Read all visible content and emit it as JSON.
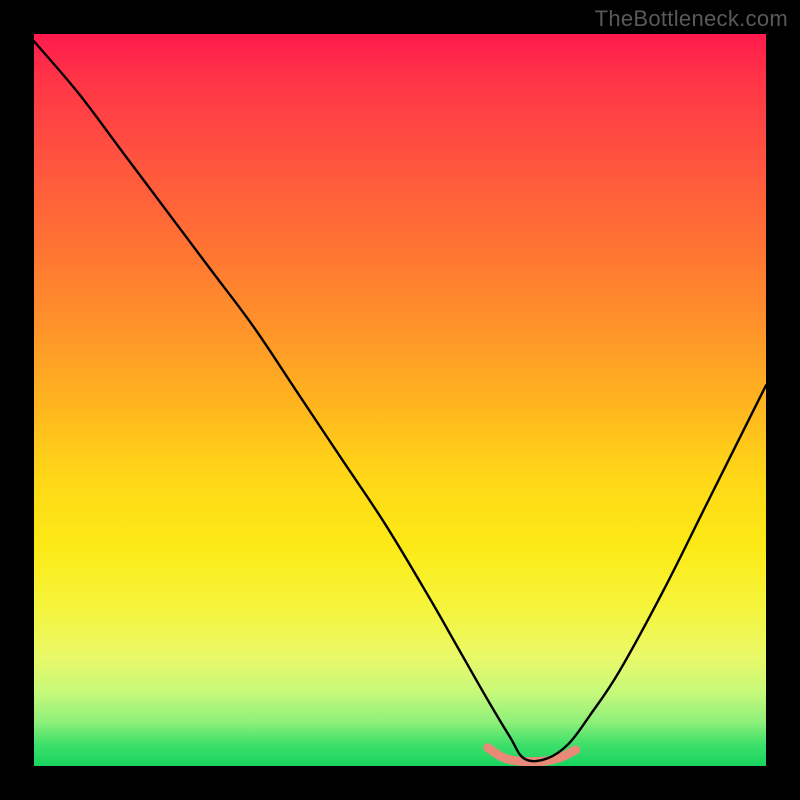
{
  "watermark": "TheBottleneck.com",
  "chart_data": {
    "type": "line",
    "title": "",
    "xlabel": "",
    "ylabel": "",
    "xlim": [
      0,
      100
    ],
    "ylim": [
      0,
      100
    ],
    "grid": false,
    "legend": false,
    "note": "Background encodes a vertical red→yellow→green gradient. Primary curve is an asymmetric V-shaped black line with its minimum near x≈67–70, y≈0. A short salmon segment sits at the trough.",
    "gradient_stops": [
      {
        "pos": 0,
        "color": "#ff1a4d"
      },
      {
        "pos": 16,
        "color": "#ff5040"
      },
      {
        "pos": 40,
        "color": "#ff932a"
      },
      {
        "pos": 60,
        "color": "#ffd617"
      },
      {
        "pos": 78,
        "color": "#f6f43a"
      },
      {
        "pos": 90,
        "color": "#c6f97a"
      },
      {
        "pos": 100,
        "color": "#17d45f"
      }
    ],
    "series": [
      {
        "name": "curve-main",
        "color": "#000000",
        "x": [
          0,
          6,
          12,
          18,
          24,
          30,
          36,
          42,
          48,
          54,
          58,
          62,
          65,
          67,
          70,
          73,
          76,
          80,
          86,
          92,
          100
        ],
        "y": [
          99,
          92,
          84,
          76,
          68,
          60,
          51,
          42,
          33,
          23,
          16,
          9,
          4,
          1,
          1,
          3,
          7,
          13,
          24,
          36,
          52
        ]
      },
      {
        "name": "trough-highlight",
        "color": "#e88a77",
        "x": [
          62,
          64,
          66,
          68,
          70,
          72,
          74
        ],
        "y": [
          2.5,
          1.2,
          0.7,
          0.6,
          0.7,
          1.2,
          2.2
        ]
      }
    ]
  }
}
